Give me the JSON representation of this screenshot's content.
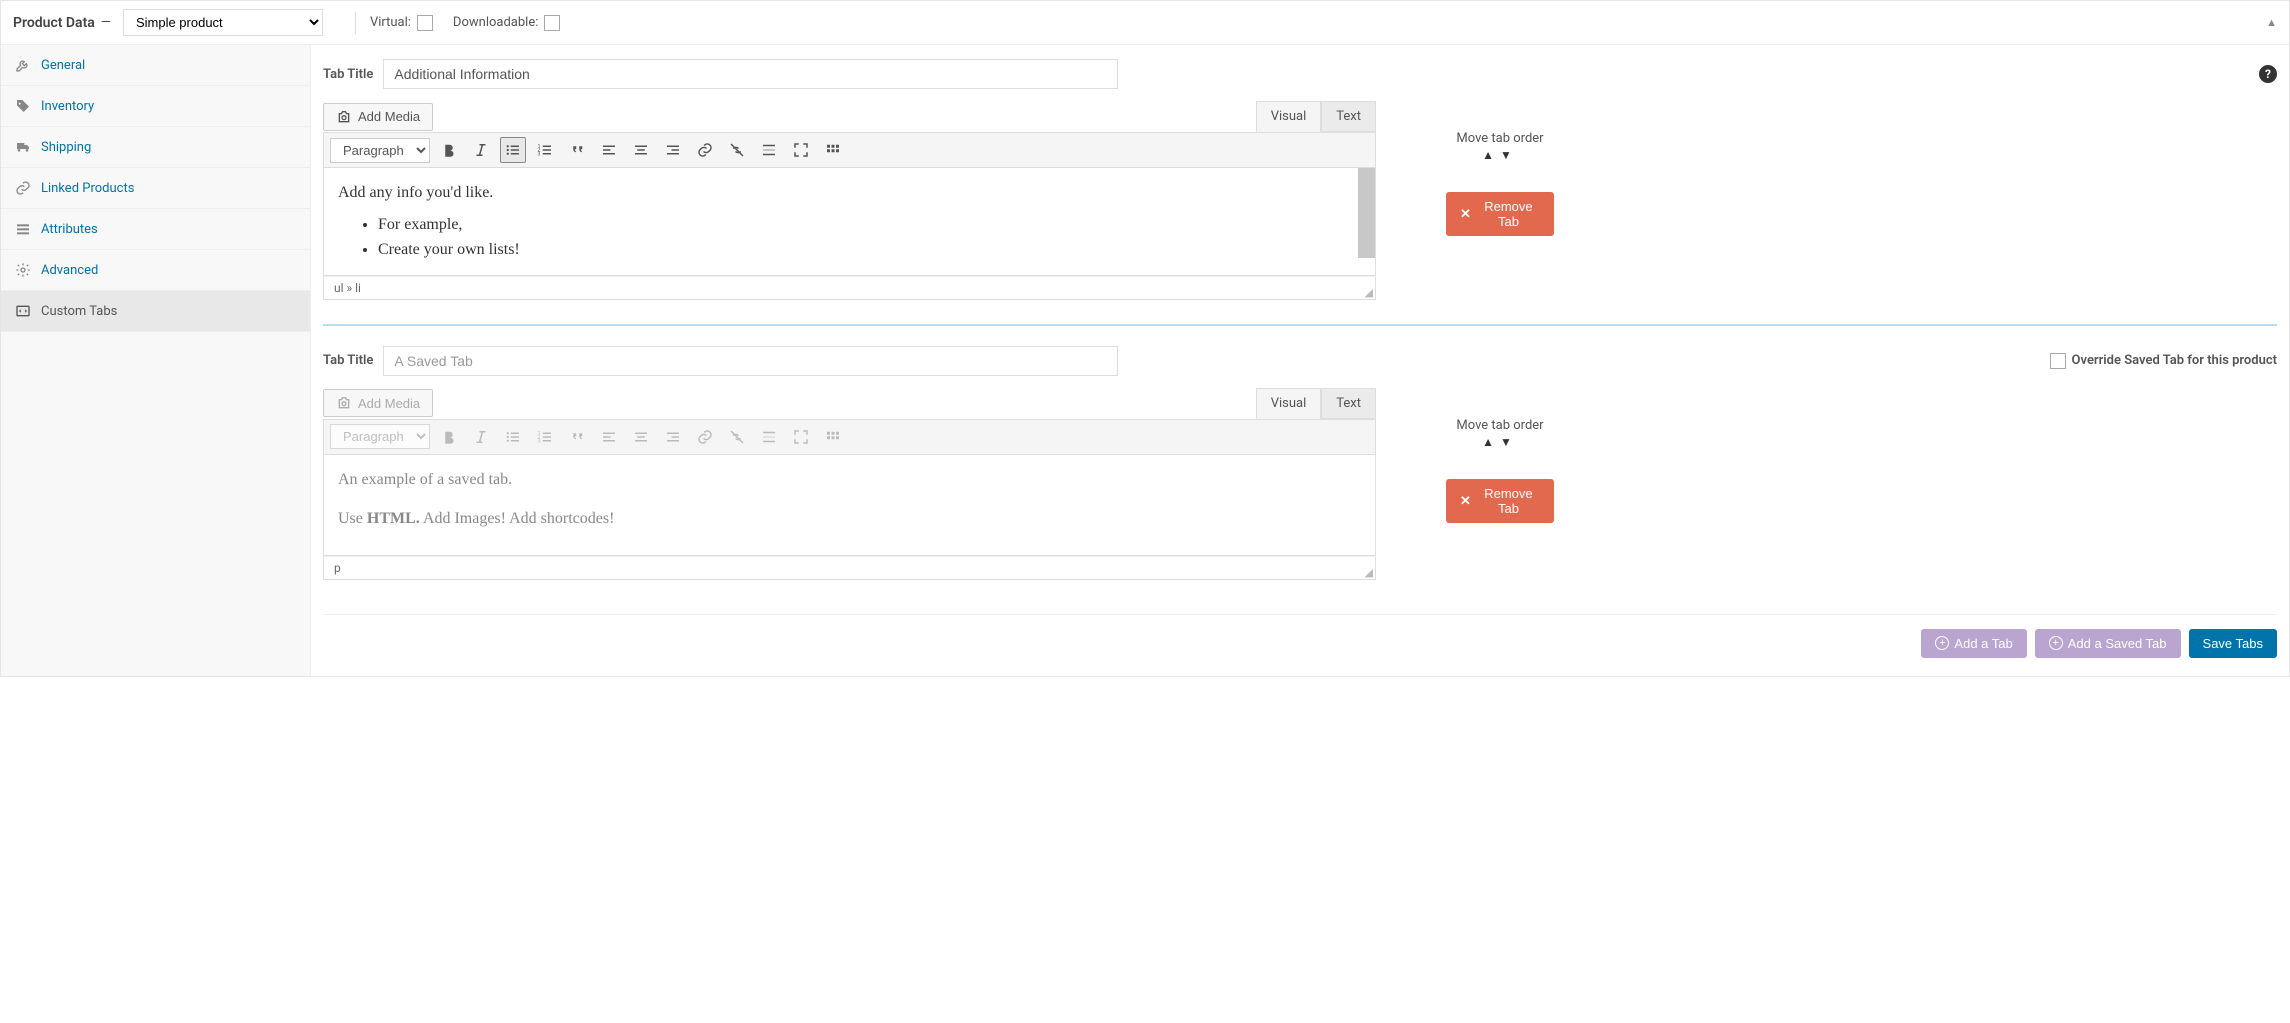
{
  "header": {
    "title": "Product Data",
    "dash": "—",
    "productType": "Simple product",
    "virtualLabel": "Virtual:",
    "downloadableLabel": "Downloadable:"
  },
  "sidebar": {
    "items": [
      {
        "label": "General"
      },
      {
        "label": "Inventory"
      },
      {
        "label": "Shipping"
      },
      {
        "label": "Linked Products"
      },
      {
        "label": "Attributes"
      },
      {
        "label": "Advanced"
      },
      {
        "label": "Custom Tabs"
      }
    ]
  },
  "tabs": [
    {
      "titleLabel": "Tab Title",
      "titleValue": "Additional Information",
      "addMedia": "Add Media",
      "visual": "Visual",
      "text": "Text",
      "paragraph": "Paragraph",
      "content": {
        "intro": "Add any info you'd like.",
        "li1": "For example,",
        "li2": "Create your own lists!"
      },
      "path": "ul » li",
      "moveLabel": "Move tab order",
      "removeLabel": "Remove Tab"
    },
    {
      "titleLabel": "Tab Title",
      "titleValue": "A Saved Tab",
      "overrideLabel": "Override Saved Tab for this product",
      "addMedia": "Add Media",
      "visual": "Visual",
      "text": "Text",
      "paragraph": "Paragraph",
      "content": {
        "line1a": "An example of a saved tab.",
        "line2a": "Use ",
        "line2b": "HTML.",
        "line2c": " Add Images! Add shortcodes!"
      },
      "path": "p",
      "moveLabel": "Move tab order",
      "removeLabel": "Remove Tab"
    }
  ],
  "footer": {
    "addTab": "Add a Tab",
    "addSaved": "Add a Saved Tab",
    "save": "Save Tabs"
  }
}
